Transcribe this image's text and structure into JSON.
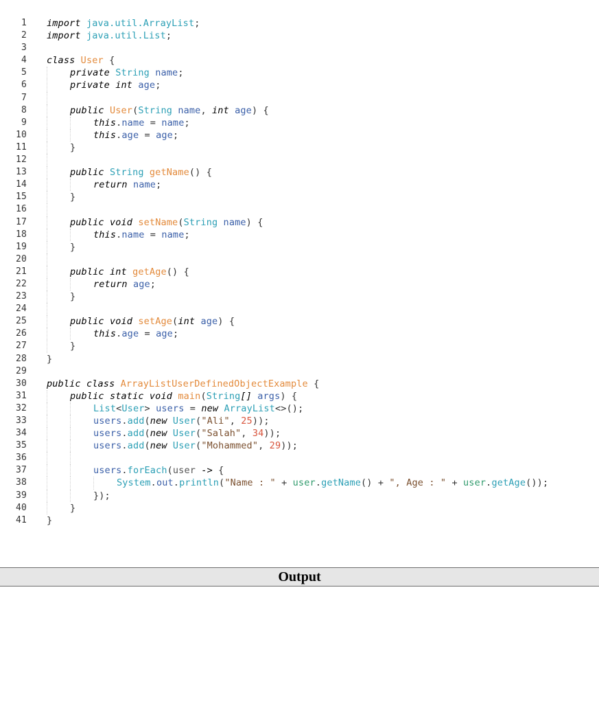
{
  "editor": {
    "lines": [
      {
        "n": "1",
        "indent": 0,
        "tokens": [
          [
            "kw",
            "import"
          ],
          [
            "pl",
            " "
          ],
          [
            "pkg",
            "java.util.ArrayList"
          ],
          [
            "pl",
            ";"
          ]
        ]
      },
      {
        "n": "2",
        "indent": 0,
        "tokens": [
          [
            "kw",
            "import"
          ],
          [
            "pl",
            " "
          ],
          [
            "pkg",
            "java.util.List"
          ],
          [
            "pl",
            ";"
          ]
        ]
      },
      {
        "n": "3",
        "indent": 0,
        "tokens": []
      },
      {
        "n": "4",
        "indent": 0,
        "tokens": [
          [
            "kw",
            "class"
          ],
          [
            "pl",
            " "
          ],
          [
            "cls",
            "User"
          ],
          [
            "pl",
            " {"
          ]
        ]
      },
      {
        "n": "5",
        "indent": 1,
        "tokens": [
          [
            "kw",
            "private"
          ],
          [
            "pl",
            " "
          ],
          [
            "type",
            "String"
          ],
          [
            "pl",
            " "
          ],
          [
            "var",
            "name"
          ],
          [
            "pl",
            ";"
          ]
        ]
      },
      {
        "n": "6",
        "indent": 1,
        "tokens": [
          [
            "kw",
            "private"
          ],
          [
            "pl",
            " "
          ],
          [
            "kw",
            "int"
          ],
          [
            "pl",
            " "
          ],
          [
            "var",
            "age"
          ],
          [
            "pl",
            ";"
          ]
        ]
      },
      {
        "n": "7",
        "indent": 1,
        "tokens": []
      },
      {
        "n": "8",
        "indent": 1,
        "tokens": [
          [
            "kw",
            "public"
          ],
          [
            "pl",
            " "
          ],
          [
            "cls",
            "User"
          ],
          [
            "pl",
            "("
          ],
          [
            "type",
            "String"
          ],
          [
            "pl",
            " "
          ],
          [
            "var",
            "name"
          ],
          [
            "pl",
            ", "
          ],
          [
            "kw",
            "int"
          ],
          [
            "pl",
            " "
          ],
          [
            "var",
            "age"
          ],
          [
            "pl",
            ") {"
          ]
        ]
      },
      {
        "n": "9",
        "indent": 2,
        "tokens": [
          [
            "kw",
            "this"
          ],
          [
            "pl",
            "."
          ],
          [
            "var",
            "name"
          ],
          [
            "pl",
            " = "
          ],
          [
            "var",
            "name"
          ],
          [
            "pl",
            ";"
          ]
        ]
      },
      {
        "n": "10",
        "indent": 2,
        "tokens": [
          [
            "kw",
            "this"
          ],
          [
            "pl",
            "."
          ],
          [
            "var",
            "age"
          ],
          [
            "pl",
            " = "
          ],
          [
            "var",
            "age"
          ],
          [
            "pl",
            ";"
          ]
        ]
      },
      {
        "n": "11",
        "indent": 1,
        "tokens": [
          [
            "pl",
            "}"
          ]
        ]
      },
      {
        "n": "12",
        "indent": 1,
        "tokens": []
      },
      {
        "n": "13",
        "indent": 1,
        "tokens": [
          [
            "kw",
            "public"
          ],
          [
            "pl",
            " "
          ],
          [
            "type",
            "String"
          ],
          [
            "pl",
            " "
          ],
          [
            "fn",
            "getName"
          ],
          [
            "pl",
            "() {"
          ]
        ]
      },
      {
        "n": "14",
        "indent": 2,
        "tokens": [
          [
            "kw",
            "return"
          ],
          [
            "pl",
            " "
          ],
          [
            "var",
            "name"
          ],
          [
            "pl",
            ";"
          ]
        ]
      },
      {
        "n": "15",
        "indent": 1,
        "tokens": [
          [
            "pl",
            "}"
          ]
        ]
      },
      {
        "n": "16",
        "indent": 1,
        "tokens": []
      },
      {
        "n": "17",
        "indent": 1,
        "tokens": [
          [
            "kw",
            "public"
          ],
          [
            "pl",
            " "
          ],
          [
            "kw",
            "void"
          ],
          [
            "pl",
            " "
          ],
          [
            "fn",
            "setName"
          ],
          [
            "pl",
            "("
          ],
          [
            "type",
            "String"
          ],
          [
            "pl",
            " "
          ],
          [
            "var",
            "name"
          ],
          [
            "pl",
            ") {"
          ]
        ]
      },
      {
        "n": "18",
        "indent": 2,
        "tokens": [
          [
            "kw",
            "this"
          ],
          [
            "pl",
            "."
          ],
          [
            "var",
            "name"
          ],
          [
            "pl",
            " = "
          ],
          [
            "var",
            "name"
          ],
          [
            "pl",
            ";"
          ]
        ]
      },
      {
        "n": "19",
        "indent": 1,
        "tokens": [
          [
            "pl",
            "}"
          ]
        ]
      },
      {
        "n": "20",
        "indent": 1,
        "tokens": []
      },
      {
        "n": "21",
        "indent": 1,
        "tokens": [
          [
            "kw",
            "public"
          ],
          [
            "pl",
            " "
          ],
          [
            "kw",
            "int"
          ],
          [
            "pl",
            " "
          ],
          [
            "fn",
            "getAge"
          ],
          [
            "pl",
            "() {"
          ]
        ]
      },
      {
        "n": "22",
        "indent": 2,
        "tokens": [
          [
            "kw",
            "return"
          ],
          [
            "pl",
            " "
          ],
          [
            "var",
            "age"
          ],
          [
            "pl",
            ";"
          ]
        ]
      },
      {
        "n": "23",
        "indent": 1,
        "tokens": [
          [
            "pl",
            "}"
          ]
        ]
      },
      {
        "n": "24",
        "indent": 1,
        "tokens": []
      },
      {
        "n": "25",
        "indent": 1,
        "tokens": [
          [
            "kw",
            "public"
          ],
          [
            "pl",
            " "
          ],
          [
            "kw",
            "void"
          ],
          [
            "pl",
            " "
          ],
          [
            "fn",
            "setAge"
          ],
          [
            "pl",
            "("
          ],
          [
            "kw",
            "int"
          ],
          [
            "pl",
            " "
          ],
          [
            "var",
            "age"
          ],
          [
            "pl",
            ") {"
          ]
        ]
      },
      {
        "n": "26",
        "indent": 2,
        "tokens": [
          [
            "kw",
            "this"
          ],
          [
            "pl",
            "."
          ],
          [
            "var",
            "age"
          ],
          [
            "pl",
            " = "
          ],
          [
            "var",
            "age"
          ],
          [
            "pl",
            ";"
          ]
        ]
      },
      {
        "n": "27",
        "indent": 1,
        "tokens": [
          [
            "pl",
            "}"
          ]
        ]
      },
      {
        "n": "28",
        "indent": 0,
        "tokens": [
          [
            "pl",
            "}"
          ]
        ]
      },
      {
        "n": "29",
        "indent": 0,
        "tokens": []
      },
      {
        "n": "30",
        "indent": 0,
        "tokens": [
          [
            "kw",
            "public"
          ],
          [
            "pl",
            " "
          ],
          [
            "kw",
            "class"
          ],
          [
            "pl",
            " "
          ],
          [
            "cls",
            "ArrayListUserDefinedObjectExample"
          ],
          [
            "pl",
            " {"
          ]
        ]
      },
      {
        "n": "31",
        "indent": 1,
        "tokens": [
          [
            "kw",
            "public"
          ],
          [
            "pl",
            " "
          ],
          [
            "kw",
            "static"
          ],
          [
            "pl",
            " "
          ],
          [
            "kw",
            "void"
          ],
          [
            "pl",
            " "
          ],
          [
            "fn",
            "main"
          ],
          [
            "pl",
            "("
          ],
          [
            "type",
            "String"
          ],
          [
            "kw",
            "[]"
          ],
          [
            "pl",
            " "
          ],
          [
            "var",
            "args"
          ],
          [
            "pl",
            ") {"
          ]
        ]
      },
      {
        "n": "32",
        "indent": 2,
        "tokens": [
          [
            "type",
            "List"
          ],
          [
            "pl",
            "<"
          ],
          [
            "type",
            "User"
          ],
          [
            "pl",
            "> "
          ],
          [
            "var",
            "users"
          ],
          [
            "pl",
            " = "
          ],
          [
            "kw",
            "new"
          ],
          [
            "pl",
            " "
          ],
          [
            "type",
            "ArrayList"
          ],
          [
            "pl",
            "<>();"
          ]
        ]
      },
      {
        "n": "33",
        "indent": 2,
        "tokens": [
          [
            "var",
            "users"
          ],
          [
            "pl",
            "."
          ],
          [
            "call",
            "add"
          ],
          [
            "pl",
            "("
          ],
          [
            "kw",
            "new"
          ],
          [
            "pl",
            " "
          ],
          [
            "type",
            "User"
          ],
          [
            "pl",
            "("
          ],
          [
            "str",
            "\"Ali\""
          ],
          [
            "pl",
            ", "
          ],
          [
            "num",
            "25"
          ],
          [
            "pl",
            "));"
          ]
        ]
      },
      {
        "n": "34",
        "indent": 2,
        "tokens": [
          [
            "var",
            "users"
          ],
          [
            "pl",
            "."
          ],
          [
            "call",
            "add"
          ],
          [
            "pl",
            "("
          ],
          [
            "kw",
            "new"
          ],
          [
            "pl",
            " "
          ],
          [
            "type",
            "User"
          ],
          [
            "pl",
            "("
          ],
          [
            "str",
            "\"Salah\""
          ],
          [
            "pl",
            ", "
          ],
          [
            "num",
            "34"
          ],
          [
            "pl",
            "));"
          ]
        ]
      },
      {
        "n": "35",
        "indent": 2,
        "tokens": [
          [
            "var",
            "users"
          ],
          [
            "pl",
            "."
          ],
          [
            "call",
            "add"
          ],
          [
            "pl",
            "("
          ],
          [
            "kw",
            "new"
          ],
          [
            "pl",
            " "
          ],
          [
            "type",
            "User"
          ],
          [
            "pl",
            "("
          ],
          [
            "str",
            "\"Mohammed\""
          ],
          [
            "pl",
            ", "
          ],
          [
            "num",
            "29"
          ],
          [
            "pl",
            "));"
          ]
        ]
      },
      {
        "n": "36",
        "indent": 2,
        "tokens": []
      },
      {
        "n": "37",
        "indent": 2,
        "tokens": [
          [
            "var",
            "users"
          ],
          [
            "pl",
            "."
          ],
          [
            "call",
            "forEach"
          ],
          [
            "pl",
            "("
          ],
          [
            "gray",
            "user"
          ],
          [
            "pl",
            " "
          ],
          [
            "kw",
            "->"
          ],
          [
            "pl",
            " {"
          ]
        ]
      },
      {
        "n": "38",
        "indent": 3,
        "tokens": [
          [
            "type",
            "System"
          ],
          [
            "pl",
            "."
          ],
          [
            "var",
            "out"
          ],
          [
            "pl",
            "."
          ],
          [
            "call",
            "println"
          ],
          [
            "pl",
            "("
          ],
          [
            "str",
            "\"Name : \""
          ],
          [
            "pl",
            " + "
          ],
          [
            "mem",
            "user"
          ],
          [
            "pl",
            "."
          ],
          [
            "call",
            "getName"
          ],
          [
            "pl",
            "() + "
          ],
          [
            "str",
            "\", Age : \""
          ],
          [
            "pl",
            " + "
          ],
          [
            "mem",
            "user"
          ],
          [
            "pl",
            "."
          ],
          [
            "call",
            "getAge"
          ],
          [
            "pl",
            "());"
          ]
        ]
      },
      {
        "n": "39",
        "indent": 2,
        "tokens": [
          [
            "pl",
            "});"
          ]
        ]
      },
      {
        "n": "40",
        "indent": 1,
        "tokens": [
          [
            "pl",
            "}"
          ]
        ]
      },
      {
        "n": "41",
        "indent": 0,
        "tokens": [
          [
            "pl",
            "}"
          ]
        ]
      }
    ]
  },
  "output": {
    "title": "Output"
  }
}
